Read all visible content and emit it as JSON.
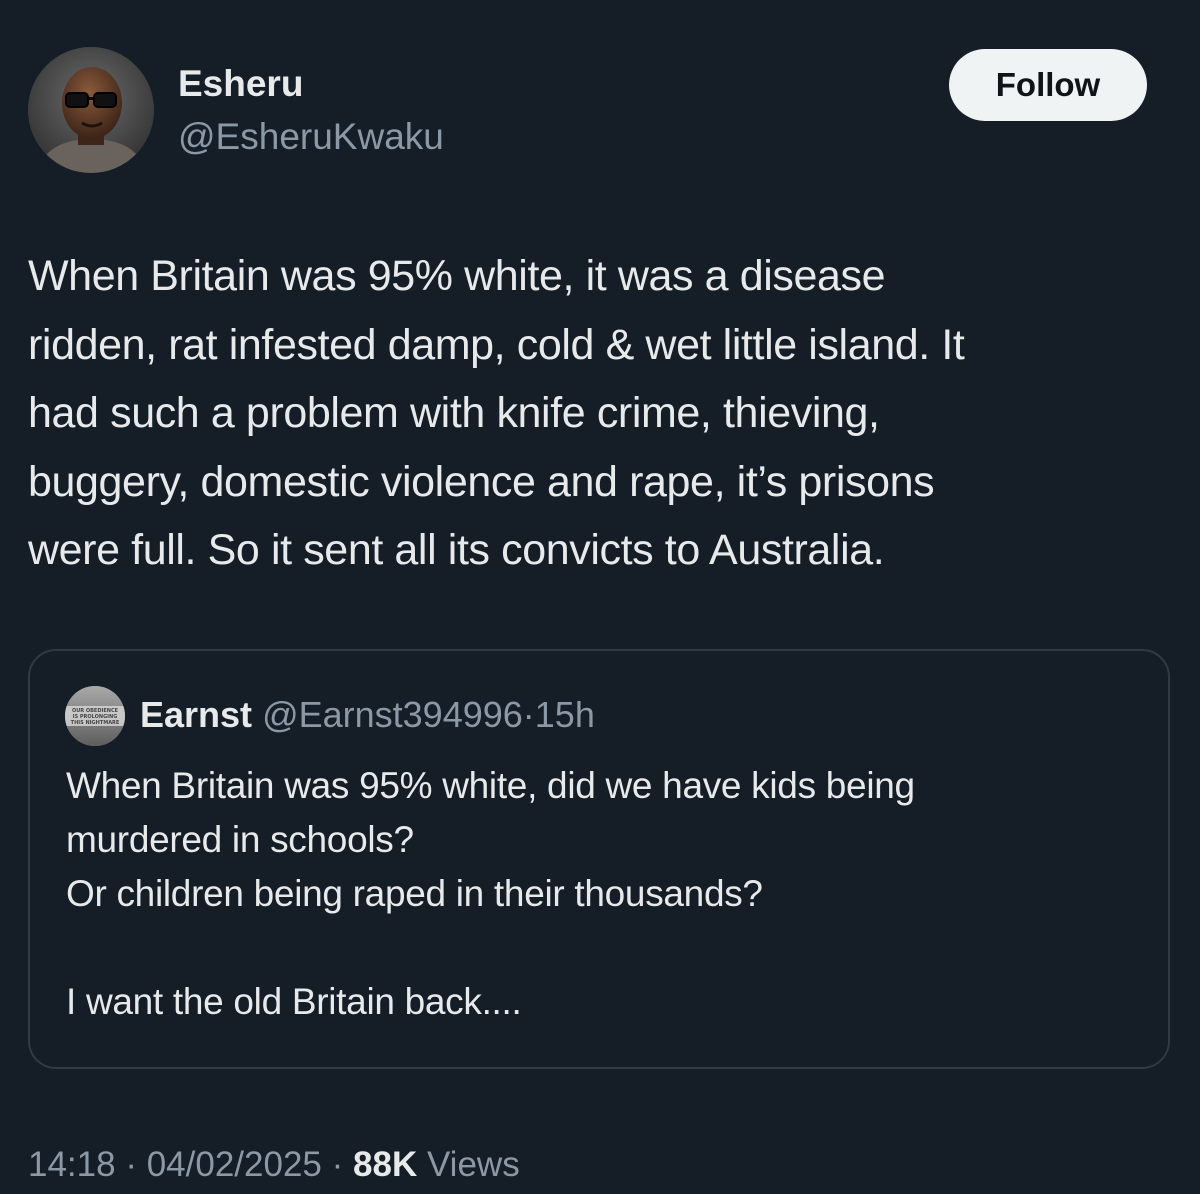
{
  "post": {
    "author": {
      "name": "Esheru",
      "handle": "@EsheruKwaku"
    },
    "follow_label": "Follow",
    "text": "When Britain was 95% white, it was a disease\nridden, rat infested damp, cold & wet little island. It\nhad such a problem with knife crime, thieving,\nbuggery, domestic violence and rape, it’s prisons\nwere full. So it sent all its convicts to Australia.",
    "quoted": {
      "name": "Earnst",
      "handle": "@Earnst394996",
      "separator": "·",
      "age": "15h",
      "text": "When Britain was 95% white, did we have kids being\nmurdered in schools?\nOr children being raped in their thousands?\n\nI want the old Britain back....",
      "avatar_text": [
        "OUR OBEDIENCE",
        "IS PROLONGING",
        "THIS NIGHTMARE"
      ]
    },
    "time": "14:18",
    "date": "04/02/2025",
    "separator": "·",
    "views_count": "88K",
    "views_label": "Views"
  },
  "colors": {
    "background": "#151d27",
    "text_primary": "#e7e9ea",
    "text_secondary": "#8b98a5",
    "border": "#2f3a45",
    "follow_bg": "#eff3f4"
  },
  "icons": {
    "avatar": "profile-photo",
    "quoted_avatar": "profile-photo"
  }
}
